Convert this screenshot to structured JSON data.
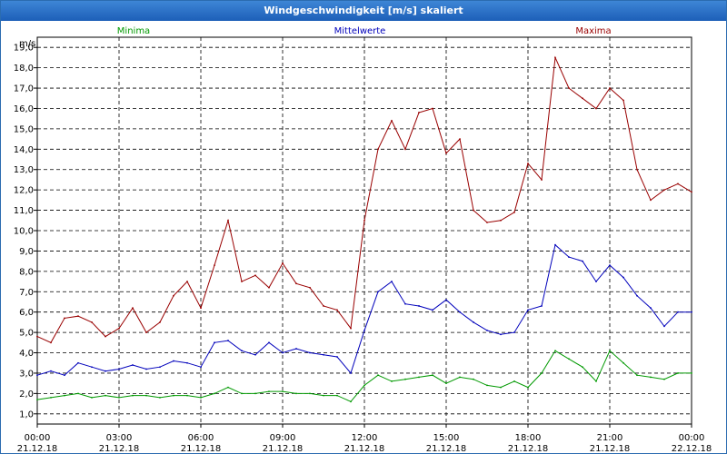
{
  "window": {
    "title": "Windgeschwindigkeit [m/s] skaliert"
  },
  "colors": {
    "minima": "#009900",
    "mittel": "#0000bb",
    "maxima": "#990000",
    "grid": "#000000",
    "title_bar": "#1d5fb8"
  },
  "chart_data": {
    "type": "line",
    "title": "Windgeschwindigkeit [m/s] skaliert",
    "ylabel": "m/s",
    "xlabel": "",
    "ylim": [
      0.5,
      19.5
    ],
    "xlim": [
      0,
      24
    ],
    "grid": true,
    "legend_placement": "top",
    "y_ticks": [
      "1,0",
      "2,0",
      "3,0",
      "4,0",
      "5,0",
      "6,0",
      "7,0",
      "8,0",
      "9,0",
      "10,0",
      "11,0",
      "12,0",
      "13,0",
      "14,0",
      "15,0",
      "16,0",
      "17,0",
      "18,0",
      "19,0"
    ],
    "y_tick_values": [
      1,
      2,
      3,
      4,
      5,
      6,
      7,
      8,
      9,
      10,
      11,
      12,
      13,
      14,
      15,
      16,
      17,
      18,
      19
    ],
    "x_ticks": [
      {
        "time": "00:00",
        "date": "21.12.18",
        "hour": 0
      },
      {
        "time": "03:00",
        "date": "21.12.18",
        "hour": 3
      },
      {
        "time": "06:00",
        "date": "21.12.18",
        "hour": 6
      },
      {
        "time": "09:00",
        "date": "21.12.18",
        "hour": 9
      },
      {
        "time": "12:00",
        "date": "21.12.18",
        "hour": 12
      },
      {
        "time": "15:00",
        "date": "21.12.18",
        "hour": 15
      },
      {
        "time": "18:00",
        "date": "21.12.18",
        "hour": 18
      },
      {
        "time": "21:00",
        "date": "21.12.18",
        "hour": 21
      },
      {
        "time": "00:00",
        "date": "22.12.18",
        "hour": 24
      }
    ],
    "series": [
      {
        "name": "Minima",
        "color": "#009900",
        "x": [
          0,
          0.5,
          1,
          1.5,
          2,
          2.5,
          3,
          3.5,
          4,
          4.5,
          5,
          5.5,
          6,
          6.5,
          7,
          7.5,
          8,
          8.5,
          9,
          9.5,
          10,
          10.5,
          11,
          11.5,
          12,
          12.5,
          13,
          13.5,
          14,
          14.5,
          15,
          15.5,
          16,
          16.5,
          17,
          17.5,
          18,
          18.5,
          19,
          19.5,
          20,
          20.5,
          21,
          21.5,
          22,
          22.5,
          23,
          23.5,
          24
        ],
        "values": [
          1.7,
          1.8,
          1.9,
          2.0,
          1.8,
          1.9,
          1.8,
          1.9,
          1.9,
          1.8,
          1.9,
          1.9,
          1.8,
          2.0,
          2.3,
          2.0,
          2.0,
          2.1,
          2.1,
          2.0,
          2.0,
          1.9,
          1.9,
          1.6,
          2.4,
          2.9,
          2.6,
          2.7,
          2.8,
          2.9,
          2.5,
          2.8,
          2.7,
          2.4,
          2.3,
          2.6,
          2.3,
          3.0,
          4.1,
          3.7,
          3.3,
          2.6,
          4.1,
          3.5,
          2.9,
          2.8,
          2.7,
          3.0,
          3.0
        ]
      },
      {
        "name": "Mittelwerte",
        "color": "#0000bb",
        "x": [
          0,
          0.5,
          1,
          1.5,
          2,
          2.5,
          3,
          3.5,
          4,
          4.5,
          5,
          5.5,
          6,
          6.5,
          7,
          7.5,
          8,
          8.5,
          9,
          9.5,
          10,
          10.5,
          11,
          11.5,
          12,
          12.5,
          13,
          13.5,
          14,
          14.5,
          15,
          15.5,
          16,
          16.5,
          17,
          17.5,
          18,
          18.5,
          19,
          19.5,
          20,
          20.5,
          21,
          21.5,
          22,
          22.5,
          23,
          23.5,
          24
        ],
        "values": [
          2.9,
          3.1,
          2.9,
          3.5,
          3.3,
          3.1,
          3.2,
          3.4,
          3.2,
          3.3,
          3.6,
          3.5,
          3.3,
          4.5,
          4.6,
          4.1,
          3.9,
          4.5,
          4.0,
          4.2,
          4.0,
          3.9,
          3.8,
          3.0,
          5.1,
          7.0,
          7.5,
          6.4,
          6.3,
          6.1,
          6.6,
          6.0,
          5.5,
          5.1,
          4.9,
          5.0,
          6.1,
          6.3,
          9.3,
          8.7,
          8.5,
          7.5,
          8.3,
          7.7,
          6.8,
          6.2,
          5.3,
          6.0,
          6.0
        ]
      },
      {
        "name": "Maxima",
        "color": "#990000",
        "x": [
          0,
          0.5,
          1,
          1.5,
          2,
          2.5,
          3,
          3.5,
          4,
          4.5,
          5,
          5.5,
          6,
          6.5,
          7,
          7.5,
          8,
          8.5,
          9,
          9.5,
          10,
          10.5,
          11,
          11.5,
          12,
          12.5,
          13,
          13.5,
          14,
          14.5,
          15,
          15.5,
          16,
          16.5,
          17,
          17.5,
          18,
          18.5,
          19,
          19.5,
          20,
          20.5,
          21,
          21.5,
          22,
          22.5,
          23,
          23.5,
          24
        ],
        "values": [
          4.8,
          4.5,
          5.7,
          5.8,
          5.5,
          4.8,
          5.2,
          6.2,
          5.0,
          5.5,
          6.8,
          7.5,
          6.2,
          8.3,
          10.5,
          7.5,
          7.8,
          7.2,
          8.4,
          7.4,
          7.2,
          6.3,
          6.1,
          5.2,
          10.5,
          14.0,
          15.4,
          14.0,
          15.8,
          16.0,
          13.8,
          14.5,
          11.0,
          10.4,
          10.5,
          10.9,
          13.3,
          12.5,
          18.5,
          17.0,
          16.5,
          16.0,
          17.0,
          16.4,
          13.0,
          11.5,
          12.0,
          12.3,
          11.9
        ]
      }
    ]
  }
}
